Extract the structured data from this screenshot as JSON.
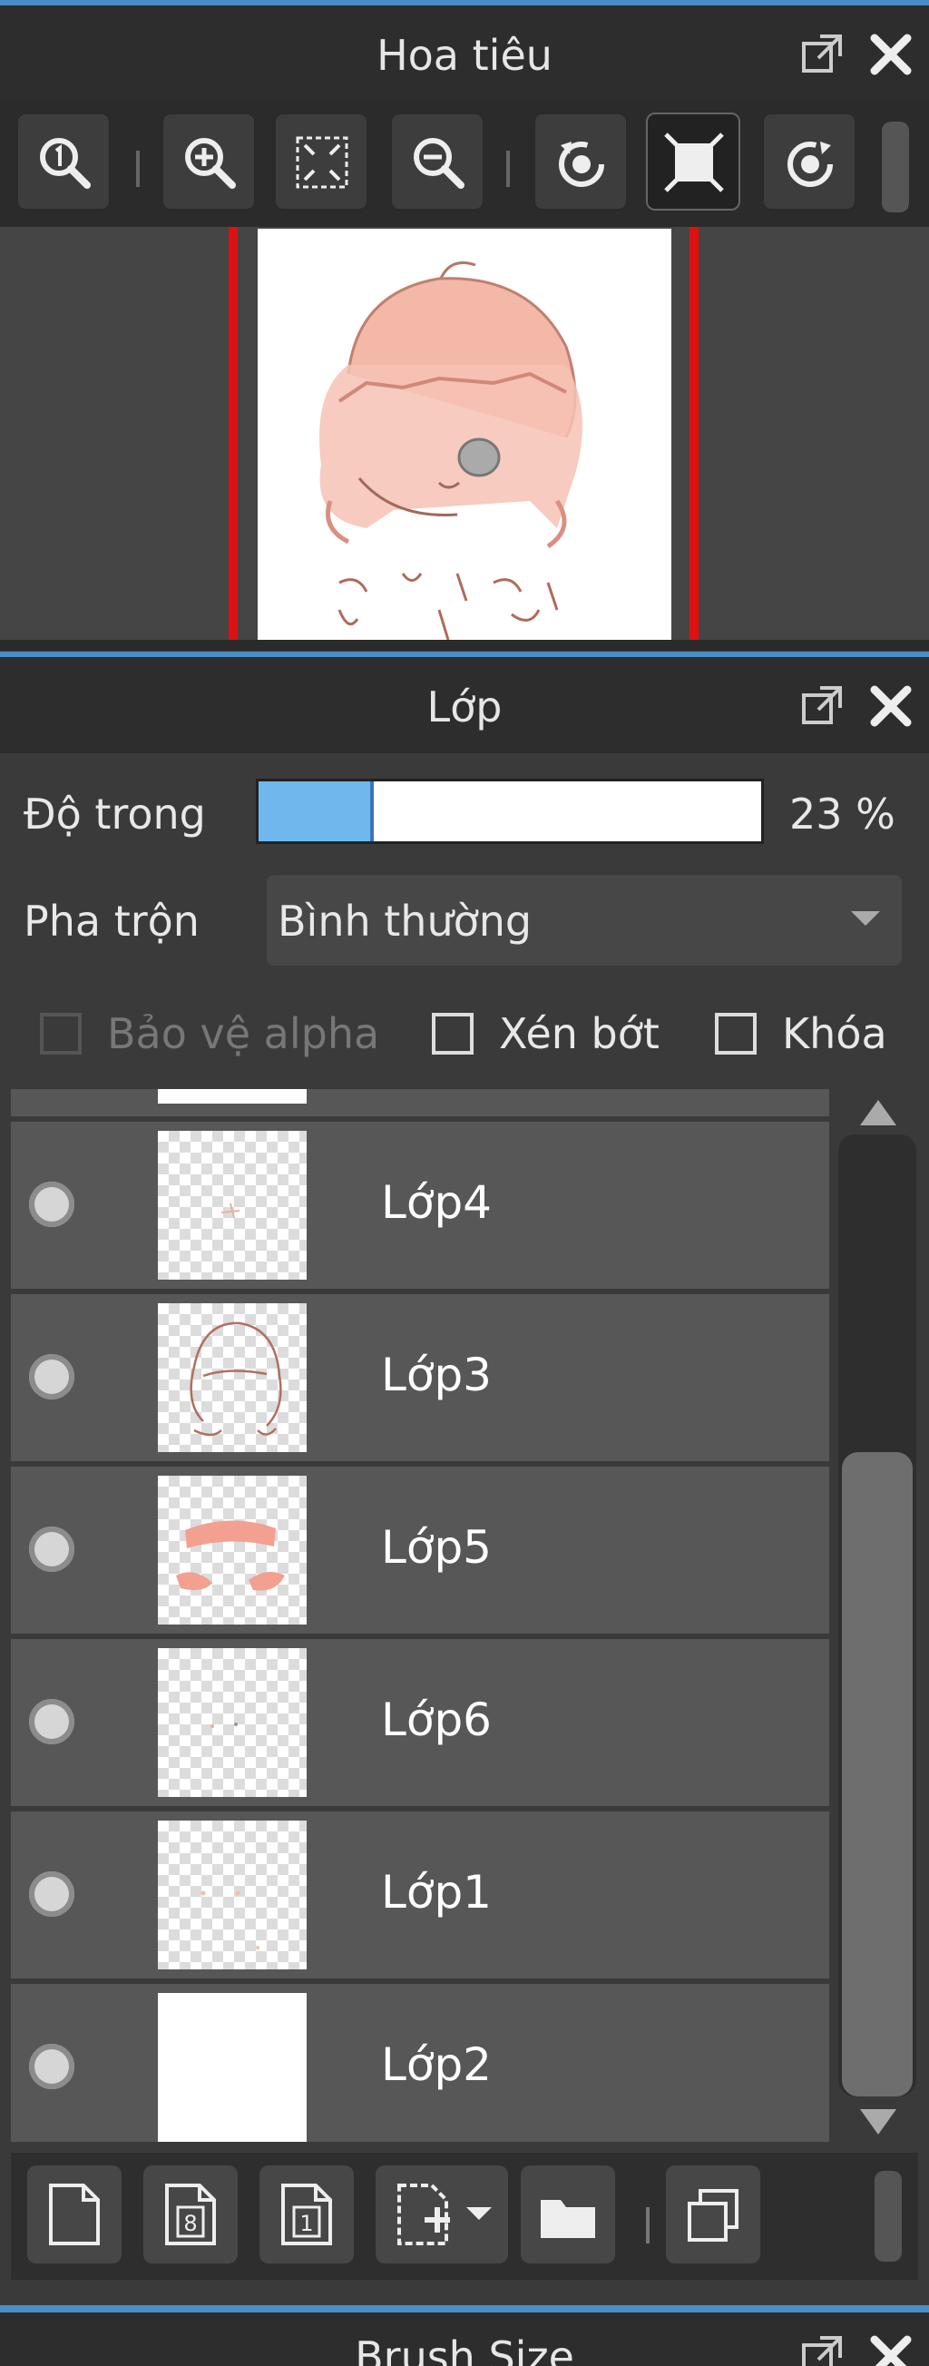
{
  "navigator": {
    "title": "Hoa tiêu",
    "toolbar": [
      "zoom-actual-size",
      "zoom-in",
      "fit-to-window",
      "zoom-out",
      "rotate-left",
      "reset-view",
      "rotate-right"
    ]
  },
  "layer_panel": {
    "title": "Lớp",
    "opacity_label": "Độ trong",
    "opacity_value": "23 %",
    "opacity_fraction": 0.23,
    "blend_label": "Pha trộn",
    "blend_value": "Bình thường",
    "protect_alpha_label": "Bảo vệ alpha",
    "clipping_label": "Xén bớt",
    "lock_label": "Khóa",
    "layers": [
      {
        "name": "Lớp4"
      },
      {
        "name": "Lớp3"
      },
      {
        "name": "Lớp5"
      },
      {
        "name": "Lớp6"
      },
      {
        "name": "Lớp1"
      },
      {
        "name": "Lớp2"
      }
    ]
  },
  "brush_panel": {
    "title": "Brush Size"
  },
  "colors": {
    "accent": "#4a8ec8",
    "frame": "#e01010",
    "opacity_fill": "#6fb8ee"
  }
}
